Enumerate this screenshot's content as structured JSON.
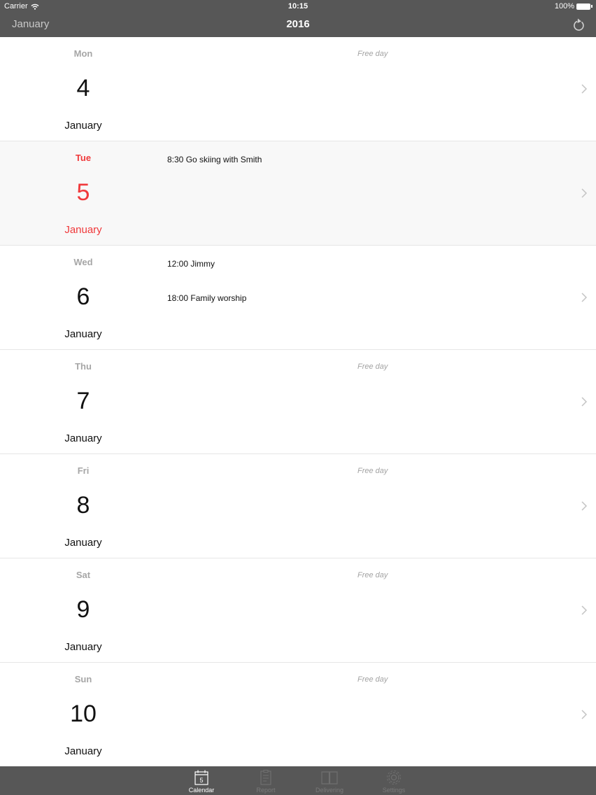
{
  "status_bar": {
    "carrier": "Carrier",
    "time": "10:15",
    "battery": "100%"
  },
  "nav": {
    "back_label": "January",
    "title": "2016",
    "refresh_icon": "refresh-icon"
  },
  "colors": {
    "accent": "#f0393b",
    "bar": "#575757",
    "muted": "#a6a6a6"
  },
  "days": [
    {
      "dow": "Mon",
      "day": "4",
      "month": "January",
      "free": "Free day",
      "events": []
    },
    {
      "dow": "Tue",
      "day": "5",
      "month": "January",
      "today": true,
      "events": [
        "8:30 Go skiing with Smith"
      ]
    },
    {
      "dow": "Wed",
      "day": "6",
      "month": "January",
      "events": [
        "12:00 Jimmy",
        "18:00 Family worship"
      ]
    },
    {
      "dow": "Thu",
      "day": "7",
      "month": "January",
      "free": "Free day",
      "events": []
    },
    {
      "dow": "Fri",
      "day": "8",
      "month": "January",
      "free": "Free day",
      "events": []
    },
    {
      "dow": "Sat",
      "day": "9",
      "month": "January",
      "free": "Free day",
      "events": []
    },
    {
      "dow": "Sun",
      "day": "10",
      "month": "January",
      "free": "Free day",
      "events": []
    }
  ],
  "tabs": [
    {
      "label": "Calendar",
      "icon": "calendar-icon",
      "badge": "5",
      "active": true
    },
    {
      "label": "Report",
      "icon": "clipboard-icon"
    },
    {
      "label": "Delivering",
      "icon": "book-icon"
    },
    {
      "label": "Settings",
      "icon": "gear-icon"
    }
  ]
}
